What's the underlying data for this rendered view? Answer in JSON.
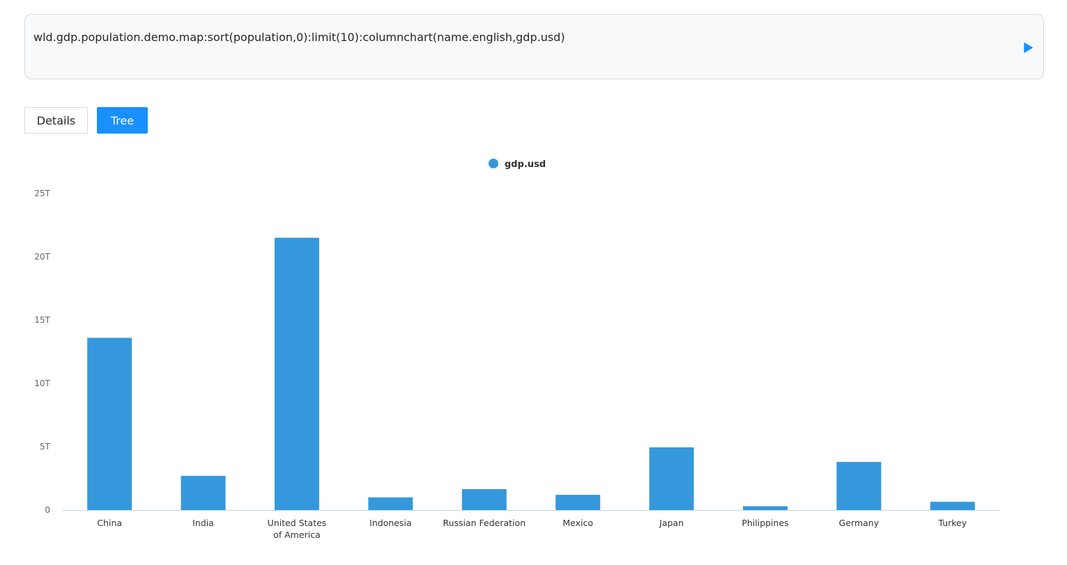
{
  "query": {
    "text": "wld.gdp.population.demo.map:sort(population,0):limit(10):columnchart(name.english,gdp.usd)"
  },
  "tabs": {
    "details_label": "Details",
    "tree_label": "Tree"
  },
  "colors": {
    "accent": "#1890ff",
    "bar": "#3598dc"
  },
  "chart_data": {
    "type": "bar",
    "legend": [
      "gdp.usd"
    ],
    "legend_position": "top-center",
    "grid": false,
    "categories": [
      "China",
      "India",
      "United States of America",
      "Indonesia",
      "Russian Federation",
      "Mexico",
      "Japan",
      "Philippines",
      "Germany",
      "Turkey"
    ],
    "series": [
      {
        "name": "gdp.usd",
        "values": [
          13.6,
          2.7,
          21.5,
          1.0,
          1.65,
          1.2,
          4.95,
          0.3,
          3.8,
          0.65
        ]
      }
    ],
    "unit": "T",
    "ylim": [
      0,
      25
    ],
    "yticks": [
      "0",
      "5T",
      "10T",
      "15T",
      "20T",
      "25T"
    ]
  }
}
